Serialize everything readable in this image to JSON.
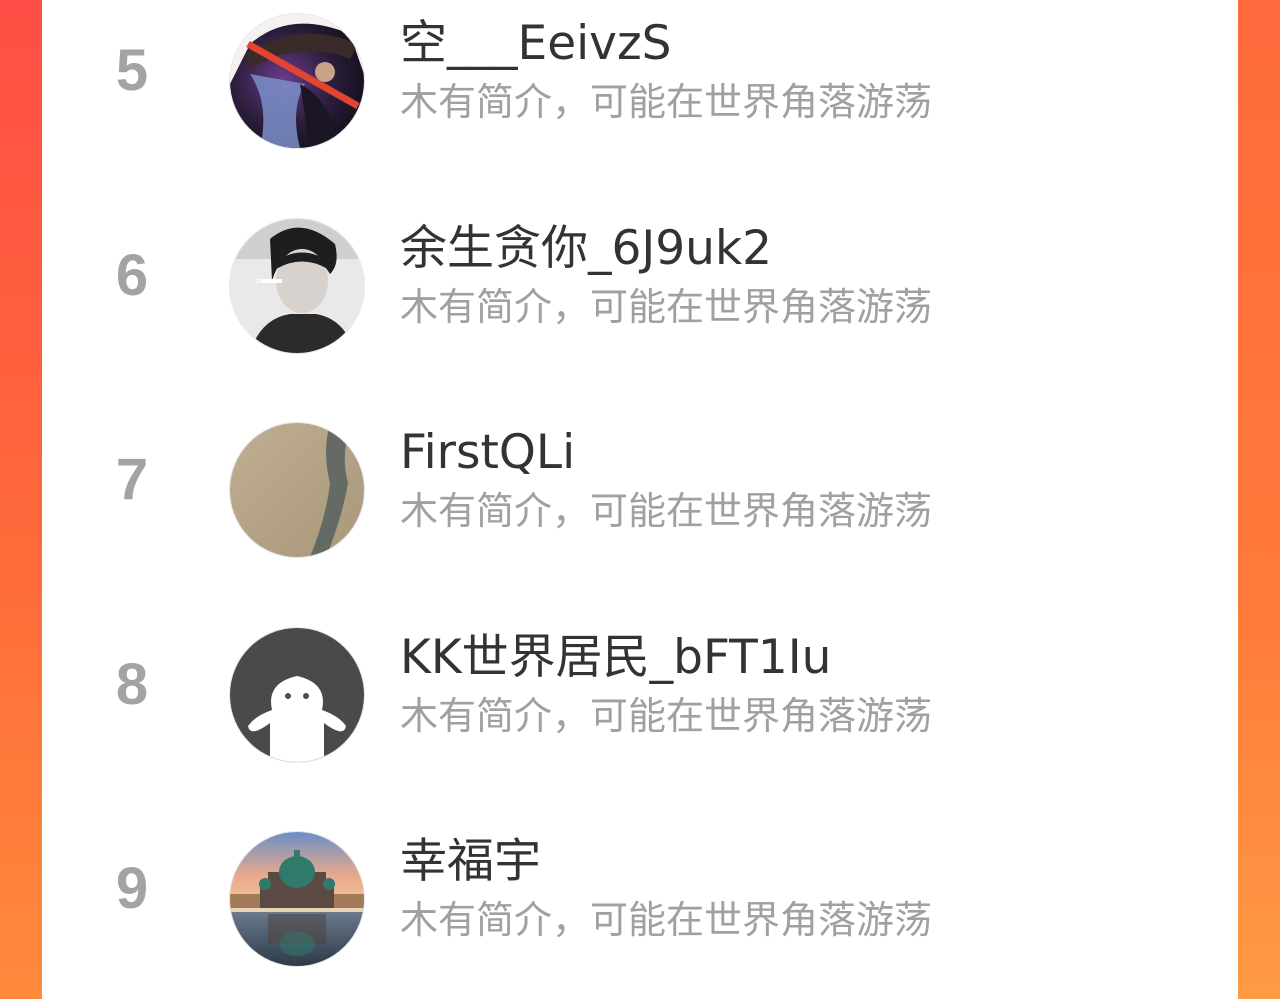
{
  "theme": {
    "accent_left": "#ff4e45",
    "accent_right": "#ff8a3c",
    "rank_color": "#a3a3a3",
    "name_color": "#333333",
    "bio_color": "#a0a0a0"
  },
  "leaderboard": {
    "rows": [
      {
        "rank": "5",
        "name": "空___EeivzS",
        "bio": "木有简介，可能在世界角落游荡",
        "avatar_icon": "samurai-art-avatar"
      },
      {
        "rank": "6",
        "name": "余生贪你_6J9uk2",
        "bio": "木有简介，可能在世界角落游荡",
        "avatar_icon": "bw-portrait-avatar"
      },
      {
        "rank": "7",
        "name": "FirstQLi",
        "bio": "木有简介，可能在世界角落游荡",
        "avatar_icon": "sand-shadow-avatar"
      },
      {
        "rank": "8",
        "name": "KK世界居民_bFT1Iu",
        "bio": "木有简介，可能在世界角落游荡",
        "avatar_icon": "default-ghost-avatar"
      },
      {
        "rank": "9",
        "name": "幸福宇",
        "bio": "木有简介，可能在世界角落游荡",
        "avatar_icon": "cathedral-photo-avatar"
      }
    ]
  }
}
